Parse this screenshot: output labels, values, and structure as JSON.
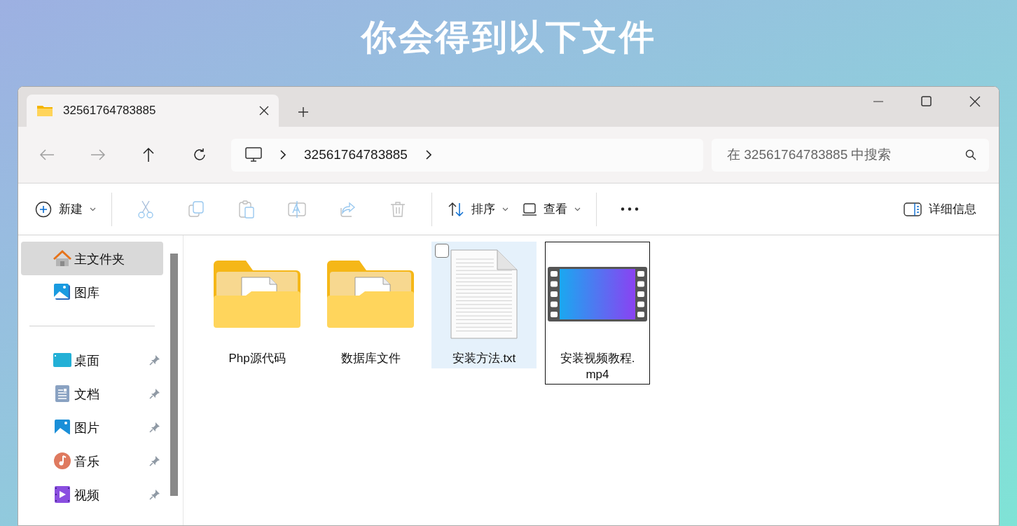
{
  "heading": "你会得到以下文件",
  "window": {
    "tab": {
      "title": "32561764783885",
      "selected": true
    }
  },
  "address_bar": {
    "path": [
      "32561764783885"
    ]
  },
  "search": {
    "placeholder": "在 32561764783885 中搜索"
  },
  "toolbar": [
    {
      "kind": "menu",
      "label": "新建"
    },
    {
      "kind": "icon",
      "disabled": true
    },
    {
      "kind": "icon",
      "disabled": true
    },
    {
      "kind": "icon",
      "disabled": true
    },
    {
      "kind": "icon",
      "disabled": true
    },
    {
      "kind": "icon",
      "disabled": true
    },
    {
      "kind": "icon",
      "disabled": true
    },
    {
      "kind": "menu",
      "label": "排序"
    },
    {
      "kind": "menu",
      "label": "查看"
    },
    {
      "kind": "more"
    },
    {
      "kind": "details",
      "label": "详细信息"
    }
  ],
  "sidebar": {
    "top_items": [
      {
        "label": "主文件夹",
        "selected": true
      },
      {
        "label": "图库",
        "selected": false
      }
    ],
    "quick_access": [
      {
        "label": "桌面",
        "pinned": true
      },
      {
        "label": "文档",
        "pinned": true
      },
      {
        "label": "图片",
        "pinned": true
      },
      {
        "label": "音乐",
        "pinned": true
      },
      {
        "label": "视频",
        "pinned": true
      }
    ]
  },
  "files": [
    {
      "kind": "folder",
      "name": "Php源代码",
      "selected": false,
      "focused": false
    },
    {
      "kind": "folder",
      "name": "数据库文件",
      "selected": false,
      "focused": false
    },
    {
      "kind": "text",
      "name": "安装方法.txt",
      "selected": true,
      "focused": false
    },
    {
      "kind": "video",
      "name": "安装视频教程.mp4",
      "selected": false,
      "focused": true
    }
  ]
}
